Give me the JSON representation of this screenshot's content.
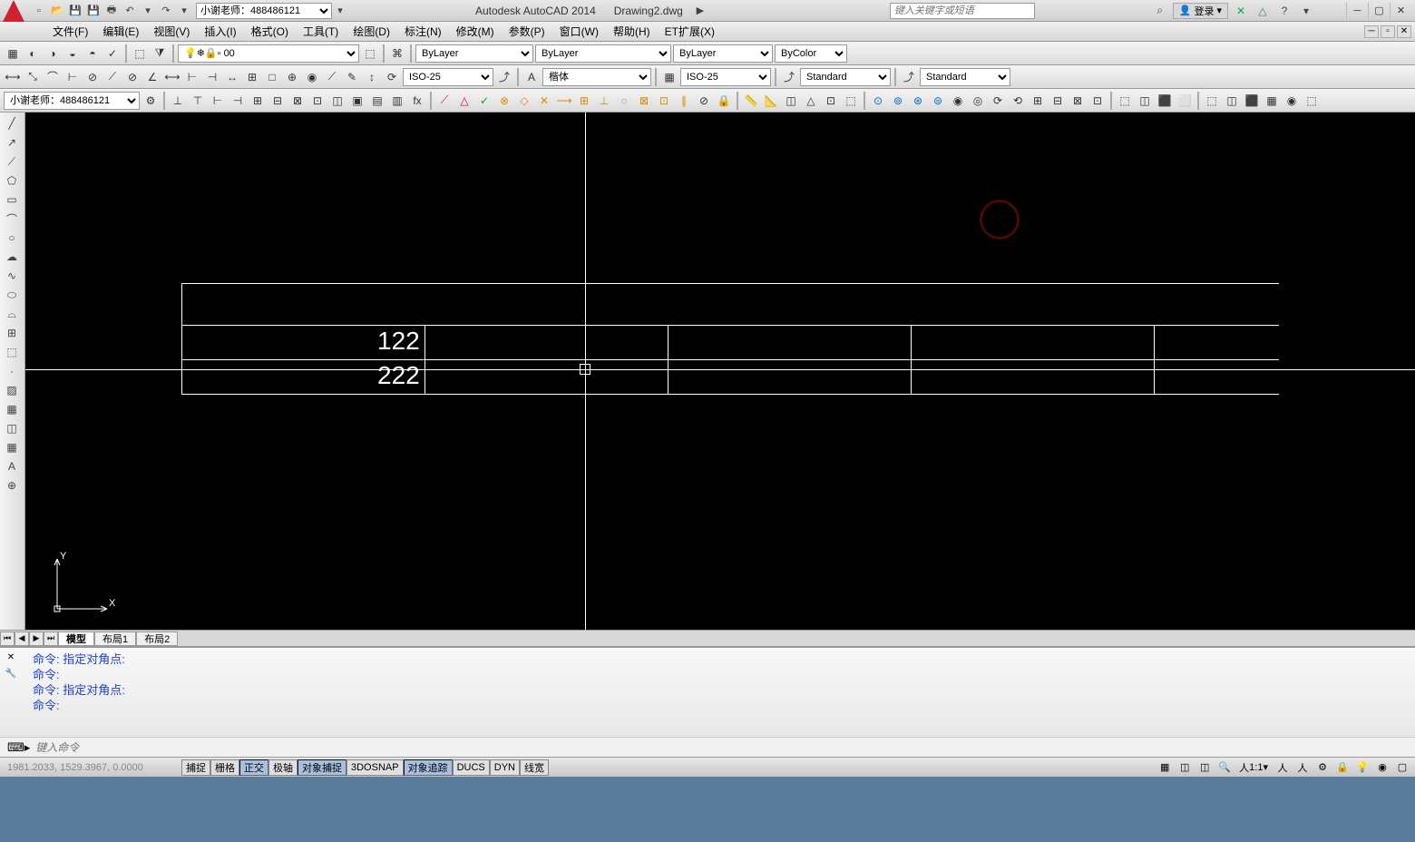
{
  "app": {
    "title": "Autodesk AutoCAD 2014",
    "document": "Drawing2.dwg",
    "search_placeholder": "键入关键字或短语",
    "login": "登录",
    "profile": "小谢老师：488486121"
  },
  "menu": {
    "items": [
      "文件(F)",
      "编辑(E)",
      "视图(V)",
      "插入(I)",
      "格式(O)",
      "工具(T)",
      "绘图(D)",
      "标注(N)",
      "修改(M)",
      "参数(P)",
      "窗口(W)",
      "帮助(H)",
      "ET扩展(X)"
    ]
  },
  "layers": {
    "current": "0",
    "color": "ByLayer",
    "linetype": "ByLayer",
    "lineweight": "ByLayer",
    "plotstyle": "ByColor"
  },
  "styles": {
    "dim_style": "ISO-25",
    "text_style": "楷体",
    "table_style": "ISO-25",
    "mleader": "Standard",
    "mleader2": "Standard"
  },
  "quick_select": {
    "value": "小谢老师：488486121"
  },
  "drawing": {
    "text1": "122",
    "text2": "222",
    "ucs_x": "X",
    "ucs_y": "Y"
  },
  "tabs": {
    "model": "模型",
    "layout1": "布局1",
    "layout2": "布局2"
  },
  "command": {
    "line1": "命令:  指定对角点:",
    "line2": "命令:",
    "line3": "命令:  指定对角点:",
    "line4": "命令:",
    "input_placeholder": "键入命令",
    "prompt": "⌨"
  },
  "status": {
    "coords": "1981.2033, 1529.3967, 0.0000",
    "toggles": [
      "捕捉",
      "栅格",
      "正交",
      "极轴",
      "对象捕捉",
      "3DOSNAP",
      "对象追踪",
      "DUCS",
      "DYN",
      "线宽"
    ],
    "active_toggles": [
      2,
      4,
      6
    ],
    "scale": "1:1"
  }
}
